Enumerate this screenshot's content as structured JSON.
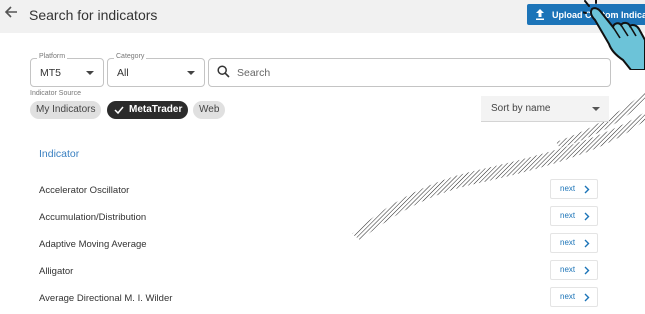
{
  "header": {
    "title": "Search for indicators",
    "upload_label": "Upload Custom Indicator",
    "accent": "#1c74b8"
  },
  "filters": {
    "platform": {
      "label": "Platform",
      "value": "MT5"
    },
    "category": {
      "label": "Category",
      "value": "All"
    },
    "search": {
      "placeholder": "Search"
    }
  },
  "source": {
    "label": "Indicator Source",
    "chips": [
      {
        "label": "My Indicators",
        "selected": false
      },
      {
        "label": "MetaTrader",
        "selected": true
      },
      {
        "label": "Web",
        "selected": false
      }
    ]
  },
  "sort": {
    "label": "Sort by name"
  },
  "table": {
    "column_header": "Indicator",
    "next_label": "next",
    "rows": [
      "Accelerator Oscillator",
      "Accumulation/Distribution",
      "Adaptive Moving Average",
      "Alligator",
      "Average Directional M. I. Wilder"
    ]
  },
  "icons": {
    "back": "arrow-left-icon",
    "upload": "upload-icon",
    "search": "search-icon",
    "check": "check-icon",
    "chevron": "chevron-right-icon",
    "pointer": "pointer-hand-icon"
  }
}
